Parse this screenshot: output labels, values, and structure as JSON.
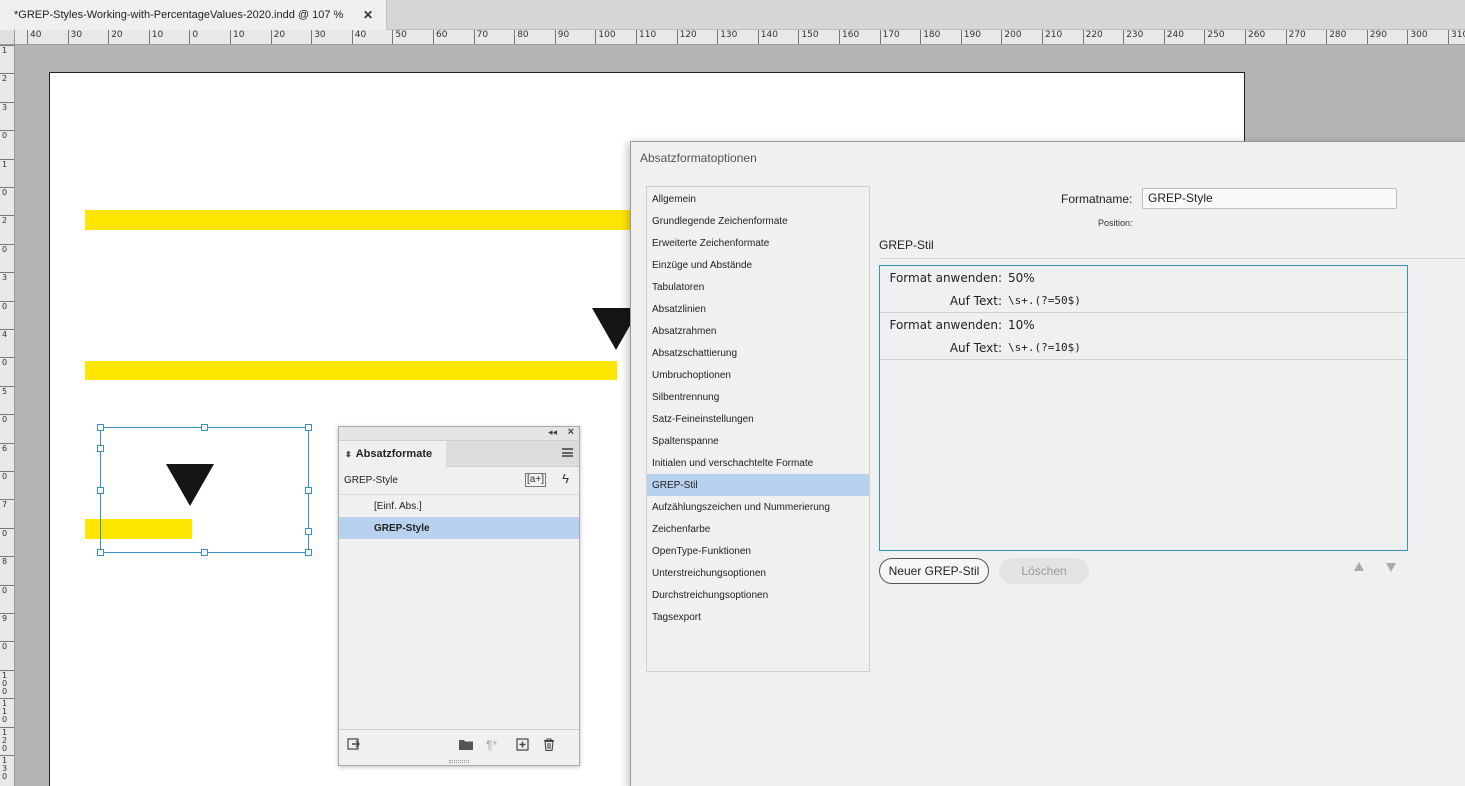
{
  "document": {
    "tab_title": "*GREP-Styles-Working-with-PercentageValues-2020.indd @ 107 %",
    "close_glyph": "✕"
  },
  "ruler_h": [
    "40",
    "30",
    "20",
    "10",
    "0",
    "10",
    "20",
    "30",
    "40",
    "50",
    "60",
    "70",
    "80",
    "90",
    "100",
    "110",
    "120",
    "130",
    "140",
    "150",
    "160",
    "170",
    "180",
    "190",
    "200",
    "210",
    "220",
    "230",
    "240",
    "250",
    "260",
    "270",
    "280",
    "290",
    "300",
    "310"
  ],
  "ruler_v": [
    "1",
    "2",
    "3",
    "0",
    "1",
    "0",
    "2",
    "0",
    "3",
    "0",
    "4",
    "0",
    "5",
    "0",
    "6",
    "0",
    "7",
    "0",
    "8",
    "0",
    "9",
    "0",
    "100",
    "110",
    "120",
    "130"
  ],
  "colors": {
    "highlight": "#ffe600",
    "selection": "#b7d1ee",
    "frame_border": "#3a8fc4"
  },
  "paragraph_styles_panel": {
    "title": "Absatzformate",
    "current_style": "GREP-Style",
    "icon_new_style_from": "[a+]",
    "icon_quick": "ϟ",
    "items": [
      {
        "label": "[Einf. Abs.]"
      },
      {
        "label": "GREP-Style",
        "selected": true
      }
    ],
    "icons": [
      "load-styles-icon",
      "folder-icon",
      "clear-overrides-icon",
      "new-style-icon",
      "trash-icon"
    ]
  },
  "dialog": {
    "title": "Absatzformatoptionen",
    "format_name_label": "Formatname:",
    "format_name_value": "GREP-Style",
    "position_label": "Position:",
    "section_title": "GREP-Stil",
    "categories": [
      "Allgemein",
      "Grundlegende Zeichenformate",
      "Erweiterte Zeichenformate",
      "Einzüge und Abstände",
      "Tabulatoren",
      "Absatzlinien",
      "Absatzrahmen",
      "Absatzschattierung",
      "Umbruchoptionen",
      "Silbentrennung",
      "Satz-Feineinstellungen",
      "Spaltenspanne",
      "Initialen und verschachtelte Formate",
      "GREP-Stil",
      "Aufzählungszeichen und Nummerierung",
      "Zeichenfarbe",
      "OpenType-Funktionen",
      "Unterstreichungsoptionen",
      "Durchstreichungsoptionen",
      "Tagsexport"
    ],
    "selected_category": "GREP-Stil",
    "grep_styles": [
      {
        "apply_label": "Format anwenden:",
        "apply_value": "50%",
        "text_label": "Auf Text:",
        "text_value": "\\s+.(?=50$)"
      },
      {
        "apply_label": "Format anwenden:",
        "apply_value": "10%",
        "text_label": "Auf Text:",
        "text_value": "\\s+.(?=10$)"
      }
    ],
    "new_button": "Neuer GREP-Stil",
    "delete_button": "Löschen"
  }
}
